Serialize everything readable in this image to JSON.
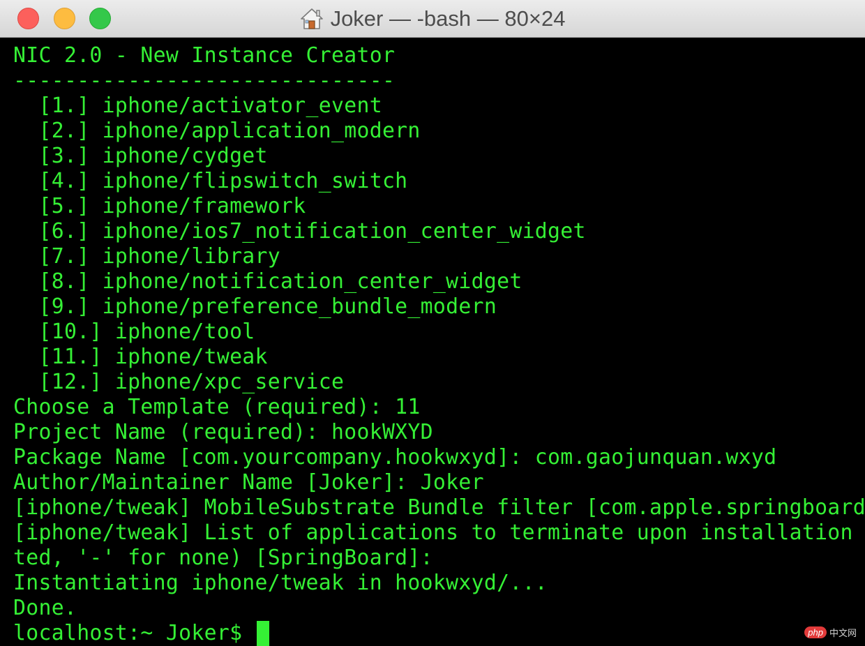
{
  "window": {
    "title": "Joker — -bash — 80×24",
    "title_icon": "home-icon"
  },
  "colors": {
    "terminal_bg": "#000000",
    "terminal_text": "#35f035",
    "close": "#fc605c",
    "minimize": "#fdbc40",
    "zoom": "#34c84a"
  },
  "terminal": {
    "lines": [
      "NIC 2.0 - New Instance Creator",
      "------------------------------",
      "  [1.] iphone/activator_event",
      "  [2.] iphone/application_modern",
      "  [3.] iphone/cydget",
      "  [4.] iphone/flipswitch_switch",
      "  [5.] iphone/framework",
      "  [6.] iphone/ios7_notification_center_widget",
      "  [7.] iphone/library",
      "  [8.] iphone/notification_center_widget",
      "  [9.] iphone/preference_bundle_modern",
      "  [10.] iphone/tool",
      "  [11.] iphone/tweak",
      "  [12.] iphone/xpc_service",
      "Choose a Template (required): 11",
      "Project Name (required): hookWXYD",
      "Package Name [com.yourcompany.hookwxyd]: com.gaojunquan.wxyd",
      "Author/Maintainer Name [Joker]: Joker",
      "[iphone/tweak] MobileSubstrate Bundle filter [com.apple.springboard]",
      "[iphone/tweak] List of applications to terminate upon installation (",
      "ted, '-' for none) [SpringBoard]:",
      "Instantiating iphone/tweak in hookwxyd/...",
      "Done."
    ],
    "prompt": "localhost:~ Joker$ "
  },
  "watermark": {
    "logo": "php",
    "text": "中文网"
  }
}
